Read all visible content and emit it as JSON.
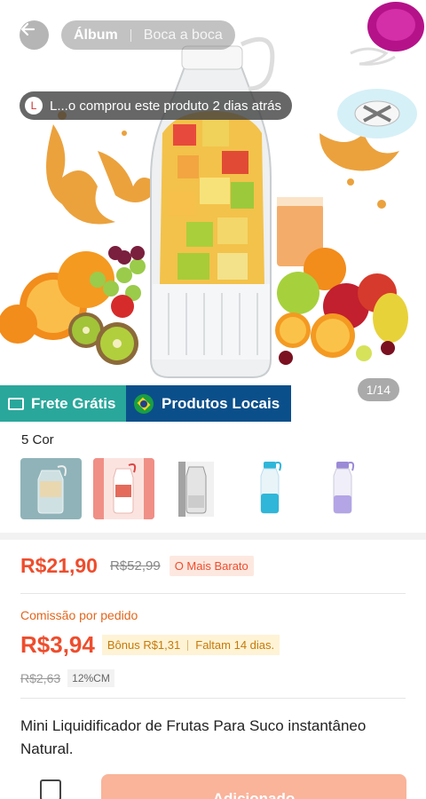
{
  "header": {
    "segments": [
      "Álbum",
      "Boca a boca"
    ]
  },
  "toast": {
    "avatar_letter": "L",
    "message": "L...o comprou este produto 2 dias atrás"
  },
  "gallery": {
    "counter": "1/14"
  },
  "badges": {
    "free_shipping": "Frete Grátis",
    "local_products": "Produtos Locais"
  },
  "variants": {
    "label": "5 Cor",
    "count": 5,
    "selected_index": 0
  },
  "pricing": {
    "price": "R$21,90",
    "original_price": "R$52,99",
    "tag": "O Mais Barato"
  },
  "commission": {
    "label": "Comissão por pedido",
    "value": "R$3,94",
    "bonus": "Bônus R$1,31",
    "deadline": "Faltam 14 dias.",
    "old_value": "R$2,63",
    "rate": "12%CM"
  },
  "product": {
    "title": "Mini Liquidificador de Frutas Para Suco instantâneo Natural."
  },
  "footer": {
    "add_button": "Adicionado"
  },
  "colors": {
    "accent": "#ee4d2d",
    "free_shipping_bg": "#2aa79b",
    "local_bg": "#0b4f8a",
    "button_bg": "#f9b49a"
  }
}
